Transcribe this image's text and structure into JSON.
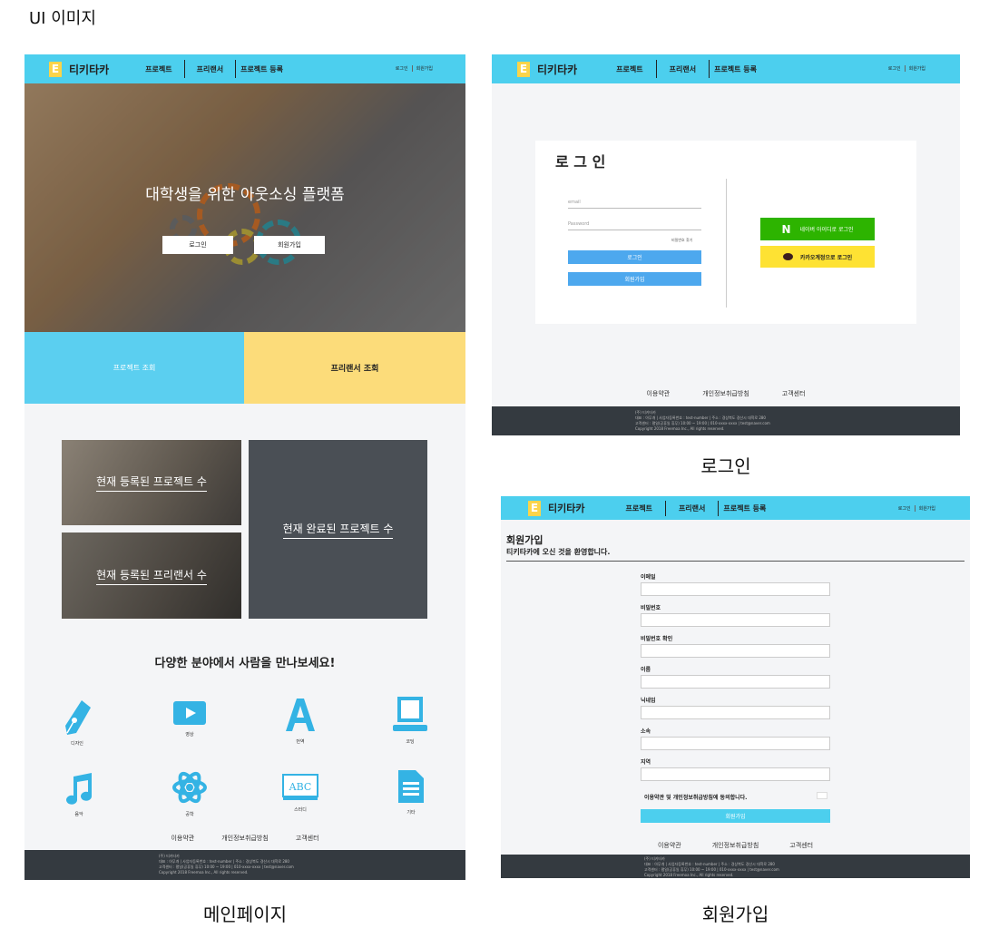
{
  "page_title": "UI 이미지",
  "captions": {
    "main": "메인페이지",
    "login": "로그인",
    "signup": "회원가입"
  },
  "brand": {
    "logo_letter": "E",
    "name": "티키타카"
  },
  "nav": {
    "projects": "프로젝트",
    "freelancers": "프리랜서",
    "register_project": "프로젝트 등록",
    "login": "로그인",
    "signup": "회원가입"
  },
  "hero": {
    "headline": "대학생을 위한 아웃소싱 플랫폼",
    "login_btn": "로그인",
    "signup_btn": "회원가입"
  },
  "browse": {
    "projects": "프로젝트 조회",
    "freelancers": "프리랜서 조회"
  },
  "stats": {
    "registered_projects": "현재 등록된 프로젝트 수",
    "registered_freelancers": "현재 등록된 프리랜서 수",
    "completed_projects": "현재 완료된 프로젝트 수"
  },
  "categories": {
    "heading": "다양한 분야에서 사람을 만나보세요!",
    "items": [
      {
        "label": "디자인",
        "icon": "pen-nib-icon"
      },
      {
        "label": "영상",
        "icon": "video-play-icon"
      },
      {
        "label": "번역",
        "icon": "letter-a-icon"
      },
      {
        "label": "코딩",
        "icon": "laptop-icon"
      },
      {
        "label": "음악",
        "icon": "music-note-icon"
      },
      {
        "label": "공학",
        "icon": "atom-icon"
      },
      {
        "label": "스터디",
        "icon": "abc-board-icon"
      },
      {
        "label": "기타",
        "icon": "document-icon"
      }
    ]
  },
  "footer": {
    "terms": "이용약관",
    "privacy": "개인정보취급방침",
    "support": "고객센터",
    "company": "(주) 티키타카",
    "line1": "대표 : 아무개 | 사업자등록번호 : test-number | 주소 : 경상북도 경산시 대학로 280",
    "line2": "고객센터 : 평일(공휴일 휴무) 10:00 ~ 19:00 | 010-xxxx-xxxx | test@naver.com",
    "line3": "Copyright 2018 Freemoa Inc., All rights reserved."
  },
  "login": {
    "title": "로 그 인",
    "email_placeholder": "email",
    "password_placeholder": "Password",
    "forgot": "비밀번호 찾기",
    "login_btn": "로그인",
    "signup_btn": "회원가입",
    "naver_btn": "네이버 아이디로 로그인",
    "kakao_btn": "카카오계정으로 로그인"
  },
  "signup": {
    "title": "회원가입",
    "subtitle": "티키타카에 오신 것을 환영합니다.",
    "fields": [
      "이메일",
      "비밀번호",
      "비밀번호 확인",
      "이름",
      "닉네임",
      "소속",
      "지역"
    ],
    "agree": "이용약관 및 개인정보취급방침에 동의합니다.",
    "submit": "회원가입"
  },
  "colors": {
    "accent_blue": "#4ccfee",
    "yellow": "#fcdc7a",
    "dark_footer": "#343a40",
    "naver_green": "#2db400",
    "kakao_yellow": "#fee233"
  }
}
